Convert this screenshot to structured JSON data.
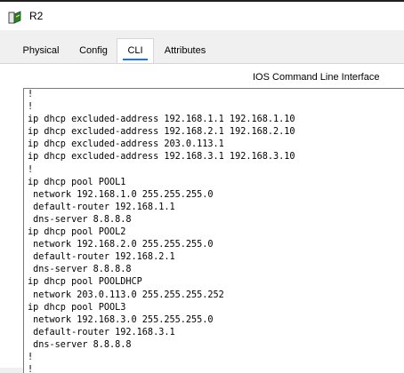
{
  "window": {
    "title": "R2",
    "icon": "router-app-icon"
  },
  "tabs": [
    {
      "label": "Physical",
      "active": false
    },
    {
      "label": "Config",
      "active": false
    },
    {
      "label": "CLI",
      "active": true
    },
    {
      "label": "Attributes",
      "active": false
    }
  ],
  "cli": {
    "header": "IOS Command Line Interface",
    "lines": [
      "!",
      "!",
      "ip dhcp excluded-address 192.168.1.1 192.168.1.10",
      "ip dhcp excluded-address 192.168.2.1 192.168.2.10",
      "ip dhcp excluded-address 203.0.113.1",
      "ip dhcp excluded-address 192.168.3.1 192.168.3.10",
      "!",
      "ip dhcp pool POOL1",
      " network 192.168.1.0 255.255.255.0",
      " default-router 192.168.1.1",
      " dns-server 8.8.8.8",
      "ip dhcp pool POOL2",
      " network 192.168.2.0 255.255.255.0",
      " default-router 192.168.2.1",
      " dns-server 8.8.8.8",
      "ip dhcp pool POOLDHCP",
      " network 203.0.113.0 255.255.255.252",
      "ip dhcp pool POOL3",
      " network 192.168.3.0 255.255.255.0",
      " default-router 192.168.3.1",
      " dns-server 8.8.8.8",
      "!",
      "!"
    ]
  },
  "colors": {
    "accent": "#1a73e8",
    "border": "#7a7a7a"
  }
}
